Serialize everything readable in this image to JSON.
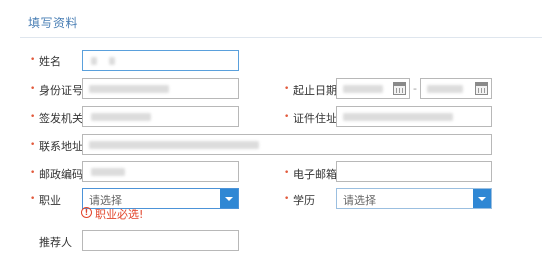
{
  "section": {
    "title": "填写资料"
  },
  "form": {
    "required_mark": "•",
    "name": {
      "label": "姓名"
    },
    "id_number": {
      "label": "身份证号"
    },
    "issuing_authority": {
      "label": "签发机关"
    },
    "address": {
      "label": "联系地址"
    },
    "postal_code": {
      "label": "邮政编码"
    },
    "validity": {
      "label": "起止日期",
      "separator": "-"
    },
    "id_address": {
      "label": "证件住址"
    },
    "email": {
      "label": "电子邮箱"
    },
    "occupation": {
      "label": "职业",
      "value": "请选择",
      "error": "职业必选!"
    },
    "education": {
      "label": "学历",
      "value": "请选择"
    },
    "referrer": {
      "label": "推荐人"
    }
  },
  "icons": {
    "calendar": "calendar-icon",
    "dropdown": "chevron-down-icon",
    "error": "exclamation-circle-icon"
  },
  "colors": {
    "section_title": "#4a7fb5",
    "required": "#e25a3c",
    "error": "#e2452b",
    "select_button": "#2f87d4"
  }
}
